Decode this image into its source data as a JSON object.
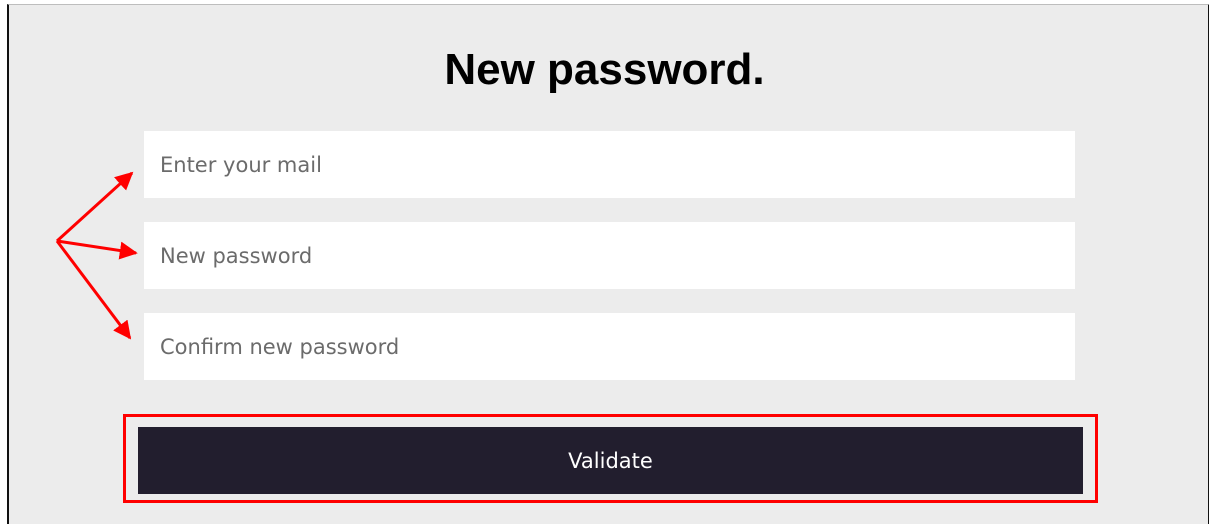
{
  "form": {
    "title": "New password.",
    "email_placeholder": "Enter your mail",
    "new_password_placeholder": "New password",
    "confirm_password_placeholder": "Confirm new password",
    "submit_label": "Validate"
  },
  "annotation": {
    "arrow_color": "#ff0000",
    "highlight_color": "#ff0000"
  },
  "colors": {
    "background": "#ececec",
    "button": "#221e2e",
    "button_text": "#ffffff"
  }
}
